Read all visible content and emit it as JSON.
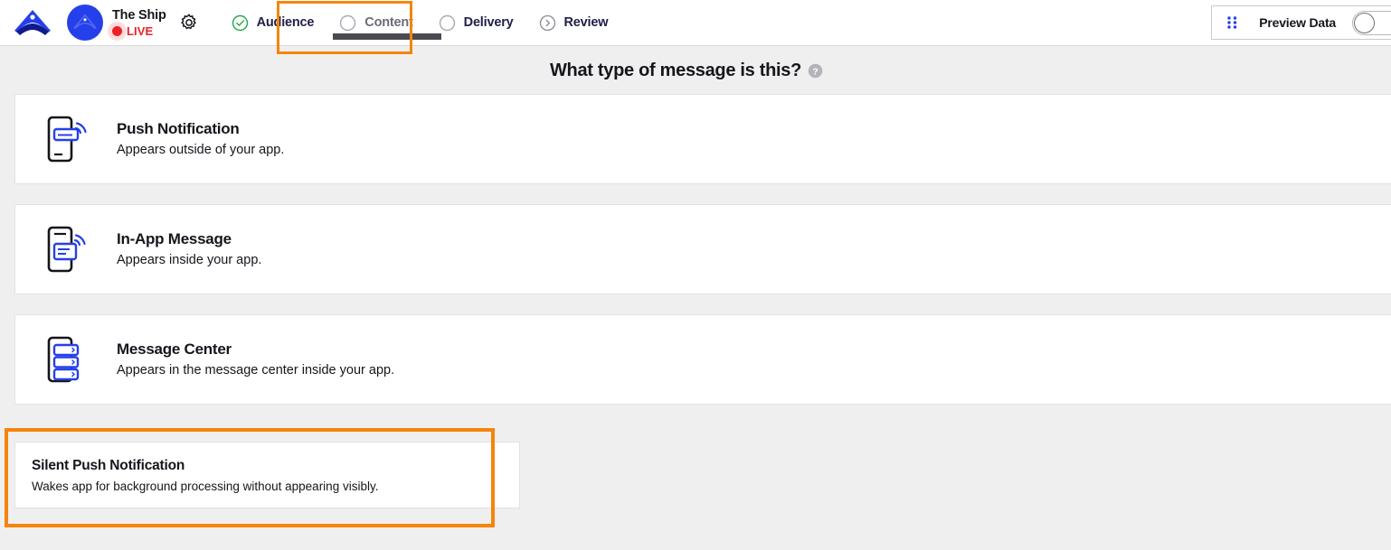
{
  "header": {
    "logo_icon": "airship-logo-icon",
    "avatar_icon": "project-avatar-icon",
    "project_name": "The Ship",
    "status_label": "LIVE",
    "settings_icon": "gear-icon",
    "tabs": [
      {
        "label": "Audience",
        "icon": "check-circle-icon",
        "state": "complete"
      },
      {
        "label": "Content",
        "icon": "empty-circle-icon",
        "state": "current"
      },
      {
        "label": "Delivery",
        "icon": "empty-circle-icon",
        "state": "upcoming"
      },
      {
        "label": "Review",
        "icon": "chevron-right-circle-icon",
        "state": "upcoming"
      }
    ],
    "preview": {
      "grid_icon": "grid-dots-icon",
      "label": "Preview Data",
      "toggle_state": "off"
    }
  },
  "main": {
    "page_title": "What type of message is this?",
    "help_icon": "help-circle-icon",
    "options": [
      {
        "title": "Push Notification",
        "subtitle": "Appears outside of your app.",
        "icon": "phone-push-icon"
      },
      {
        "title": "In-App Message",
        "subtitle": "Appears inside your app.",
        "icon": "phone-in-app-icon"
      },
      {
        "title": "Message Center",
        "subtitle": "Appears in the message center inside your app.",
        "icon": "phone-message-center-icon"
      }
    ],
    "silent_option": {
      "title": "Silent Push Notification",
      "subtitle": "Wakes app for background processing without appearing visibly."
    }
  },
  "colors": {
    "highlight": "#f5850c",
    "brand_blue": "#2540ea",
    "status_red": "#ec2027",
    "complete_green": "#29a745",
    "tab_text": "#20204a",
    "underline": "#4a4a52"
  }
}
